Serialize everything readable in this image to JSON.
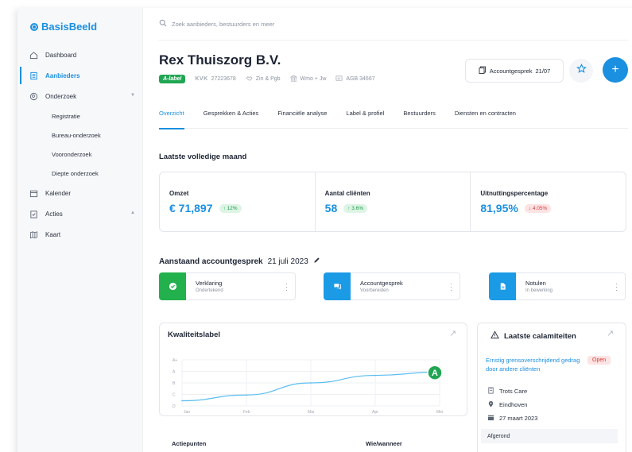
{
  "app": {
    "name": "BasisBeeld"
  },
  "search": {
    "placeholder": "Zoek aanbieders, bestuurders en meer"
  },
  "sidebar": {
    "items": [
      {
        "label": "Dashboard",
        "icon": "home-icon"
      },
      {
        "label": "Aanbieders",
        "icon": "building-icon",
        "active": true
      },
      {
        "label": "Onderzoek",
        "icon": "search-circle-icon",
        "expanded": true
      },
      {
        "label": "Kalender",
        "icon": "calendar-icon"
      },
      {
        "label": "Acties",
        "icon": "clipboard-check-icon"
      },
      {
        "label": "Kaart",
        "icon": "map-icon"
      }
    ],
    "onderzoek_sub": [
      "Registratie",
      "Bureau-onderzoek",
      "Vooronderzoek",
      "Diepte onderzoek"
    ]
  },
  "header": {
    "title": "Rex Thuiszorg B.V.",
    "label_badge": "A-label",
    "kvk_label": "KVK",
    "kvk_number": "27223678",
    "meta": [
      "Zin & Pgb",
      "Wmo + Jw",
      "AGB 34667"
    ],
    "account_button": "Accountgesprek",
    "account_date": "21/07"
  },
  "tabs": [
    "Overzicht",
    "Gesprekken & Acties",
    "Financiële analyse",
    "Label & profiel",
    "Bestuurders",
    "Diensten en contracten"
  ],
  "stats": {
    "title": "Laatste volledige maand",
    "items": [
      {
        "label": "Omzet",
        "value": "€ 71,897",
        "change": "↑ 12%",
        "direction": "up"
      },
      {
        "label": "Aantal cliënten",
        "value": "58",
        "change": "↑ 3.6%",
        "direction": "up"
      },
      {
        "label": "Uitnuttingspercentage",
        "value": "81,95%",
        "change": "↓ 4.05%",
        "direction": "down"
      }
    ]
  },
  "upcoming": {
    "title": "Aanstaand accountgesprek",
    "date": "21 juli 2023",
    "tasks": [
      {
        "name": "Verklaring",
        "status": "Ondertekend",
        "color": "#22b14c",
        "icon": "check-icon"
      },
      {
        "name": "Accountgesprek",
        "status": "Voorbereiden",
        "color": "#1b9ae6",
        "icon": "chat-icon"
      },
      {
        "name": "Notulen",
        "status": "In bewerking",
        "color": "#1b9ae6",
        "icon": "document-icon"
      }
    ]
  },
  "quality": {
    "title": "Kwaliteitslabel",
    "current_label": "A"
  },
  "chart_data": {
    "type": "line",
    "title": "Kwaliteitslabel",
    "categories": [
      "Jan",
      "Feb",
      "Mar",
      "Apr",
      "Mei"
    ],
    "y_categories": [
      "D",
      "C",
      "B",
      "A",
      "A+"
    ],
    "values": [
      0.45,
      0.95,
      2.0,
      2.65,
      2.95
    ],
    "grid": true
  },
  "calamities": {
    "title": "Laatste calamiteiten",
    "item": {
      "link": "Ernstig grensoverschrijdend gedrag door andere cliënten",
      "status": "Open",
      "organization": "Trots Care",
      "location": "Eindhoven",
      "date": "27 maart 2023"
    },
    "closed_label": "Afgerond"
  },
  "actions": {
    "columns": [
      "Actiepunten",
      "Wie/wanneer"
    ]
  },
  "colors": {
    "accent": "#1b8fe0",
    "success": "#20a653",
    "danger": "#d43d3d"
  }
}
